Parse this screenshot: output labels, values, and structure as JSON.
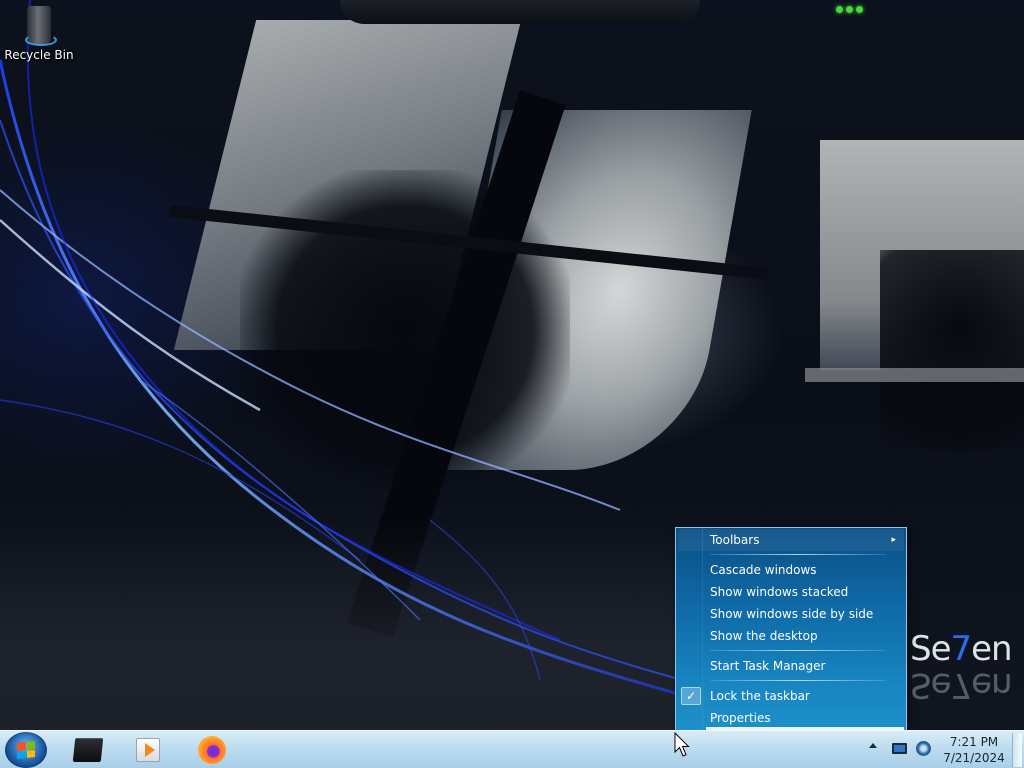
{
  "desktop": {
    "icons": [
      {
        "label": "Recycle Bin",
        "icon": "recycle-bin-icon"
      }
    ],
    "wallpaper_logo": {
      "prefix": "Se",
      "accent": "7",
      "suffix": "en",
      "accent_color": "#2a6cf0"
    }
  },
  "context_menu": {
    "items": [
      {
        "label": "Toolbars",
        "submenu": true
      },
      {
        "separator": true
      },
      {
        "label": "Cascade windows"
      },
      {
        "label": "Show windows stacked"
      },
      {
        "label": "Show windows side by side"
      },
      {
        "label": "Show the desktop"
      },
      {
        "separator": true
      },
      {
        "label": "Start Task Manager"
      },
      {
        "separator": true
      },
      {
        "label": "Lock the taskbar",
        "checked": true
      },
      {
        "label": "Properties"
      }
    ],
    "submenu_arrow": "▸",
    "check_glyph": "✓",
    "background_color": "#1784bf"
  },
  "taskbar": {
    "start_button_icon": "windows-logo-icon",
    "pinned_apps": [
      {
        "name": "Windows Explorer",
        "icon": "explorer-icon"
      },
      {
        "name": "Windows Media Player",
        "icon": "media-player-icon"
      },
      {
        "name": "Firefox",
        "icon": "firefox-icon"
      }
    ],
    "tray_icons": [
      "show-hidden-icons-arrow-icon",
      "action-center-monitor-icon",
      "network-icon"
    ],
    "clock": {
      "time": "7:21 PM",
      "date": "7/21/2024"
    }
  }
}
